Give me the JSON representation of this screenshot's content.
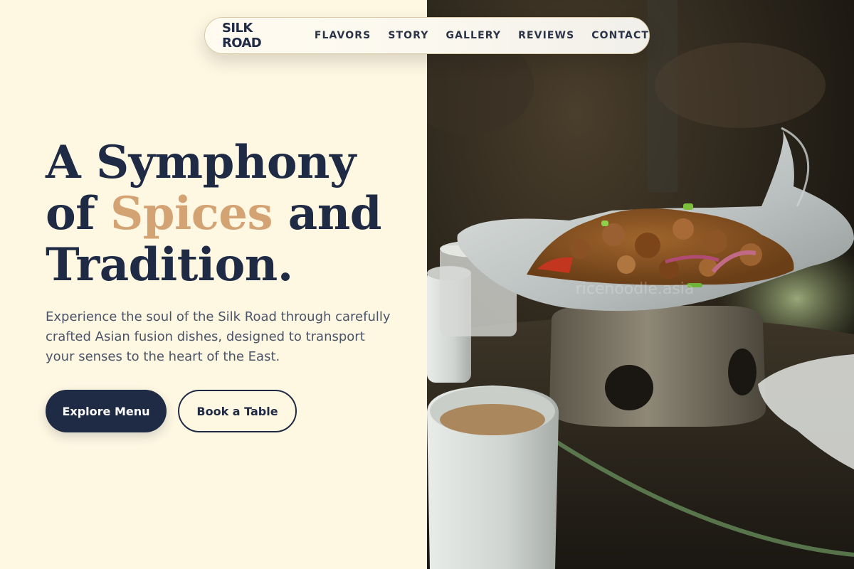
{
  "nav": {
    "brand": "SILK ROAD",
    "links": [
      "FLAVORS",
      "STORY",
      "GALLERY",
      "REVIEWS",
      "CONTACT"
    ]
  },
  "hero": {
    "headline_line1": "A Symphony",
    "headline_line2_pre": "of ",
    "headline_accent": "Spices",
    "headline_line2_post": " and",
    "headline_line3": "Tradition.",
    "description": "Experience the soul of the Silk Road through carefully crafted Asian fusion dishes, designed to transport your senses to the heart of the East.",
    "primary_cta": "Explore Menu",
    "secondary_cta": "Book a Table"
  },
  "photo": {
    "watermark": "ricenoodle.asia"
  },
  "colors": {
    "navy": "#1f2a44",
    "accent": "#d4a373",
    "cream": "#fef7e2",
    "body_text": "#4a5468"
  }
}
